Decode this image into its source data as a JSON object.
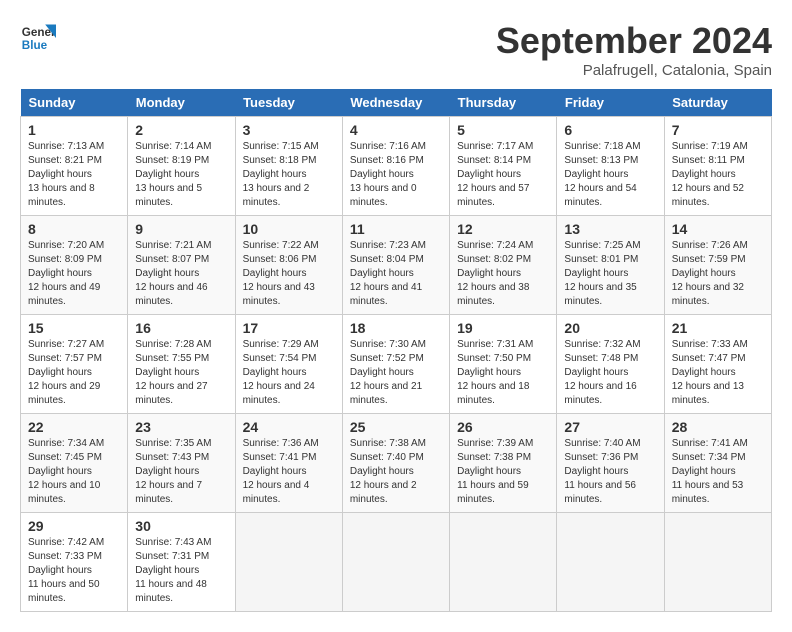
{
  "header": {
    "logo_line1": "General",
    "logo_line2": "Blue",
    "month": "September 2024",
    "location": "Palafrugell, Catalonia, Spain"
  },
  "weekdays": [
    "Sunday",
    "Monday",
    "Tuesday",
    "Wednesday",
    "Thursday",
    "Friday",
    "Saturday"
  ],
  "weeks": [
    [
      {
        "day": "1",
        "sunrise": "7:13 AM",
        "sunset": "8:21 PM",
        "daylight": "13 hours and 8 minutes."
      },
      {
        "day": "2",
        "sunrise": "7:14 AM",
        "sunset": "8:19 PM",
        "daylight": "13 hours and 5 minutes."
      },
      {
        "day": "3",
        "sunrise": "7:15 AM",
        "sunset": "8:18 PM",
        "daylight": "13 hours and 2 minutes."
      },
      {
        "day": "4",
        "sunrise": "7:16 AM",
        "sunset": "8:16 PM",
        "daylight": "13 hours and 0 minutes."
      },
      {
        "day": "5",
        "sunrise": "7:17 AM",
        "sunset": "8:14 PM",
        "daylight": "12 hours and 57 minutes."
      },
      {
        "day": "6",
        "sunrise": "7:18 AM",
        "sunset": "8:13 PM",
        "daylight": "12 hours and 54 minutes."
      },
      {
        "day": "7",
        "sunrise": "7:19 AM",
        "sunset": "8:11 PM",
        "daylight": "12 hours and 52 minutes."
      }
    ],
    [
      {
        "day": "8",
        "sunrise": "7:20 AM",
        "sunset": "8:09 PM",
        "daylight": "12 hours and 49 minutes."
      },
      {
        "day": "9",
        "sunrise": "7:21 AM",
        "sunset": "8:07 PM",
        "daylight": "12 hours and 46 minutes."
      },
      {
        "day": "10",
        "sunrise": "7:22 AM",
        "sunset": "8:06 PM",
        "daylight": "12 hours and 43 minutes."
      },
      {
        "day": "11",
        "sunrise": "7:23 AM",
        "sunset": "8:04 PM",
        "daylight": "12 hours and 41 minutes."
      },
      {
        "day": "12",
        "sunrise": "7:24 AM",
        "sunset": "8:02 PM",
        "daylight": "12 hours and 38 minutes."
      },
      {
        "day": "13",
        "sunrise": "7:25 AM",
        "sunset": "8:01 PM",
        "daylight": "12 hours and 35 minutes."
      },
      {
        "day": "14",
        "sunrise": "7:26 AM",
        "sunset": "7:59 PM",
        "daylight": "12 hours and 32 minutes."
      }
    ],
    [
      {
        "day": "15",
        "sunrise": "7:27 AM",
        "sunset": "7:57 PM",
        "daylight": "12 hours and 29 minutes."
      },
      {
        "day": "16",
        "sunrise": "7:28 AM",
        "sunset": "7:55 PM",
        "daylight": "12 hours and 27 minutes."
      },
      {
        "day": "17",
        "sunrise": "7:29 AM",
        "sunset": "7:54 PM",
        "daylight": "12 hours and 24 minutes."
      },
      {
        "day": "18",
        "sunrise": "7:30 AM",
        "sunset": "7:52 PM",
        "daylight": "12 hours and 21 minutes."
      },
      {
        "day": "19",
        "sunrise": "7:31 AM",
        "sunset": "7:50 PM",
        "daylight": "12 hours and 18 minutes."
      },
      {
        "day": "20",
        "sunrise": "7:32 AM",
        "sunset": "7:48 PM",
        "daylight": "12 hours and 16 minutes."
      },
      {
        "day": "21",
        "sunrise": "7:33 AM",
        "sunset": "7:47 PM",
        "daylight": "12 hours and 13 minutes."
      }
    ],
    [
      {
        "day": "22",
        "sunrise": "7:34 AM",
        "sunset": "7:45 PM",
        "daylight": "12 hours and 10 minutes."
      },
      {
        "day": "23",
        "sunrise": "7:35 AM",
        "sunset": "7:43 PM",
        "daylight": "12 hours and 7 minutes."
      },
      {
        "day": "24",
        "sunrise": "7:36 AM",
        "sunset": "7:41 PM",
        "daylight": "12 hours and 4 minutes."
      },
      {
        "day": "25",
        "sunrise": "7:38 AM",
        "sunset": "7:40 PM",
        "daylight": "12 hours and 2 minutes."
      },
      {
        "day": "26",
        "sunrise": "7:39 AM",
        "sunset": "7:38 PM",
        "daylight": "11 hours and 59 minutes."
      },
      {
        "day": "27",
        "sunrise": "7:40 AM",
        "sunset": "7:36 PM",
        "daylight": "11 hours and 56 minutes."
      },
      {
        "day": "28",
        "sunrise": "7:41 AM",
        "sunset": "7:34 PM",
        "daylight": "11 hours and 53 minutes."
      }
    ],
    [
      {
        "day": "29",
        "sunrise": "7:42 AM",
        "sunset": "7:33 PM",
        "daylight": "11 hours and 50 minutes."
      },
      {
        "day": "30",
        "sunrise": "7:43 AM",
        "sunset": "7:31 PM",
        "daylight": "11 hours and 48 minutes."
      },
      null,
      null,
      null,
      null,
      null
    ]
  ]
}
